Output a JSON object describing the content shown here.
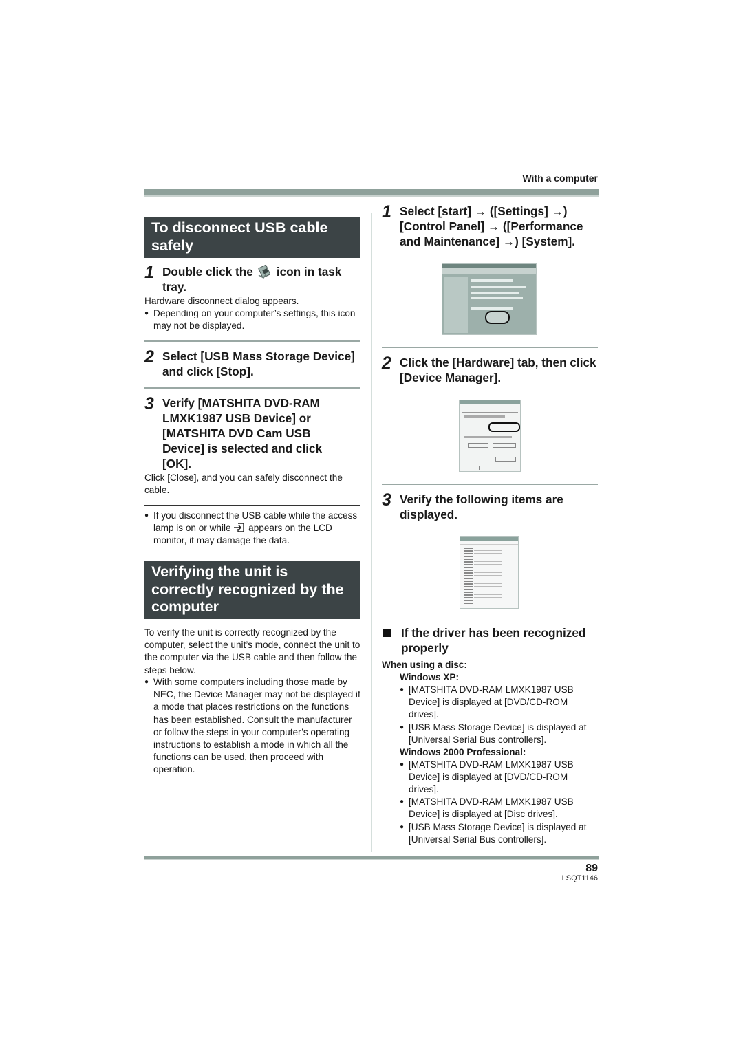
{
  "header": {
    "section_label": "With a computer"
  },
  "left_column": {
    "disconnect_heading": "To disconnect USB cable safely",
    "steps": [
      {
        "number": "1",
        "text_before_icon": "Double click the",
        "icon": "safely-remove-hardware-tray-icon",
        "text_after_icon": "icon in task tray.",
        "body": "Hardware disconnect dialog appears.",
        "bullets": [
          "Depending on your computer’s settings, this icon may not be displayed."
        ]
      },
      {
        "number": "2",
        "text": "Select [USB Mass Storage Device] and click [Stop]."
      },
      {
        "number": "3",
        "text": "Verify [MATSHITA DVD-RAM LMXK1987 USB Device] or [MATSHITA DVD Cam USB Device] is selected and click [OK].",
        "body": "Click [Close], and you can safely disconnect the cable."
      }
    ],
    "warning": {
      "before_icon": "If you disconnect the USB cable while the access lamp is on or while",
      "icon": "card-access-icon",
      "after_icon": "appears on the LCD monitor, it may damage the data."
    },
    "verify_heading": "Verifying the unit is correctly recognized by the computer",
    "verify_body": "To verify the unit is correctly recognized by the computer, select the unit’s mode, connect the unit to the computer via the USB cable and then follow the steps below.",
    "verify_bullets": [
      "With some computers including those made by NEC, the Device Manager may not be displayed if a mode that places restrictions on the functions has been established. Consult the manufacturer or follow the steps in your computer’s operating instructions to establish a mode in which all the functions can be used, then proceed with operation."
    ]
  },
  "right_column": {
    "steps": [
      {
        "number": "1",
        "text": "Select [start] → ([Settings] →) [Control Panel] → ([Performance and Maintenance] →) [System].",
        "screenshot": "control-panel-screenshot"
      },
      {
        "number": "2",
        "text": "Click the [Hardware] tab, then click [Device Manager].",
        "screenshot": "system-properties-screenshot"
      },
      {
        "number": "3",
        "text": "Verify the following items are displayed.",
        "screenshot": "device-manager-screenshot"
      }
    ],
    "recognized_heading": "If the driver has been recognized properly",
    "disc_label": "When using a disc:",
    "os_groups": [
      {
        "os": "Windows XP:",
        "bullets": [
          "[MATSHITA DVD-RAM LMXK1987 USB Device] is displayed at [DVD/CD-ROM drives].",
          "[USB Mass Storage Device] is displayed at [Universal Serial Bus controllers]."
        ]
      },
      {
        "os": "Windows 2000 Professional:",
        "bullets": [
          "[MATSHITA DVD-RAM LMXK1987 USB Device] is displayed at [DVD/CD-ROM drives].",
          "[MATSHITA DVD-RAM LMXK1987 USB Device] is displayed at [Disc drives].",
          "[USB Mass Storage Device] is displayed at [Universal Serial Bus controllers]."
        ]
      }
    ]
  },
  "footer": {
    "page_number": "89",
    "doc_code": "LSQT1146"
  },
  "colors": {
    "heading_box": "#3c4446",
    "rule": "#8fa19b",
    "divider": "#d5dfdc"
  }
}
